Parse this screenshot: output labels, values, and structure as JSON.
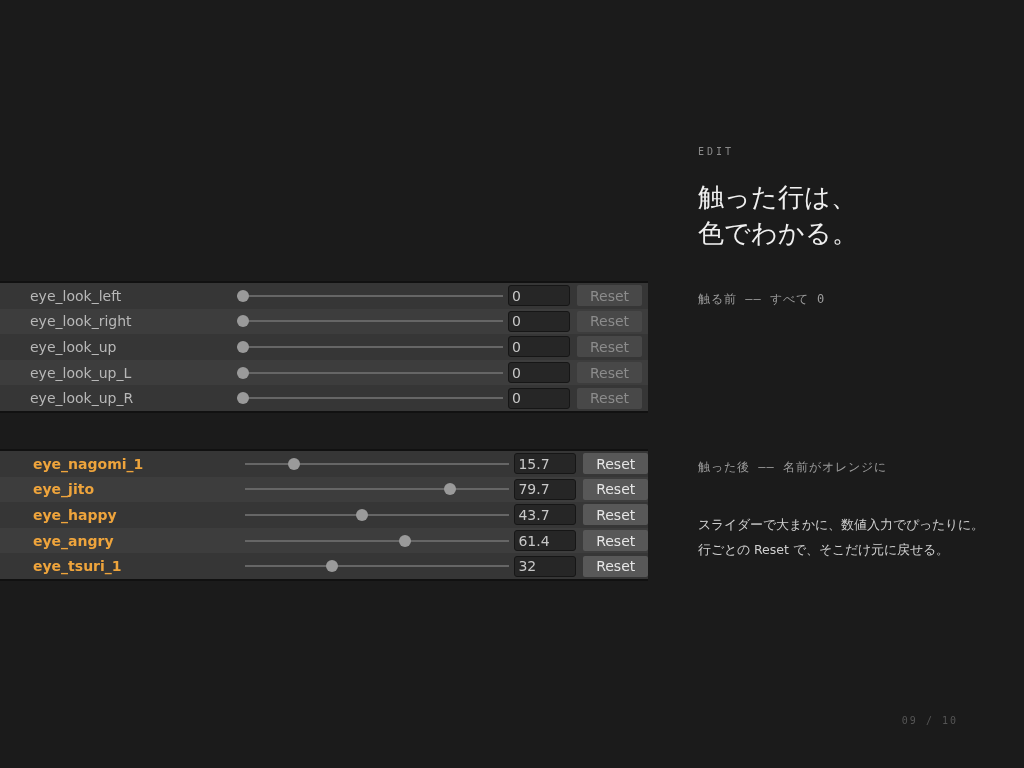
{
  "eyebrow": "EDIT",
  "heading": [
    "触った行は、",
    "色でわかる。"
  ],
  "panels": [
    {
      "note": "触る前 —— すべて 0",
      "rows": [
        {
          "name": "eye_look_left",
          "level": 0,
          "value": "0",
          "touched": false,
          "button": "Reset"
        },
        {
          "name": "eye_look_right",
          "level": 0,
          "value": "0",
          "touched": false,
          "button": "Reset"
        },
        {
          "name": "eye_look_up",
          "level": 0,
          "value": "0",
          "touched": false,
          "button": "Reset"
        },
        {
          "name": "eye_look_up_L",
          "level": 0,
          "value": "0",
          "touched": false,
          "button": "Reset"
        },
        {
          "name": "eye_look_up_R",
          "level": 0,
          "value": "0",
          "touched": false,
          "button": "Reset"
        }
      ]
    },
    {
      "note": "触った後 —— 名前がオレンジに",
      "rows": [
        {
          "name": "eye_nagomi_1",
          "level": 0.17,
          "value": "15.7",
          "touched": true,
          "button": "Reset"
        },
        {
          "name": "eye_jito",
          "level": 0.79,
          "value": "79.7",
          "touched": true,
          "button": "Reset"
        },
        {
          "name": "eye_happy",
          "level": 0.44,
          "value": "43.7",
          "touched": true,
          "button": "Reset"
        },
        {
          "name": "eye_angry",
          "level": 0.61,
          "value": "61.4",
          "touched": true,
          "button": "Reset"
        },
        {
          "name": "eye_tsuri_1",
          "level": 0.32,
          "value": "32",
          "touched": true,
          "button": "Reset"
        }
      ]
    }
  ],
  "description": [
    "スライダーで大まかに、数値入力でぴったりに。",
    "行ごとの Reset で、そこだけ元に戻せる。"
  ],
  "page": "09 / 10"
}
